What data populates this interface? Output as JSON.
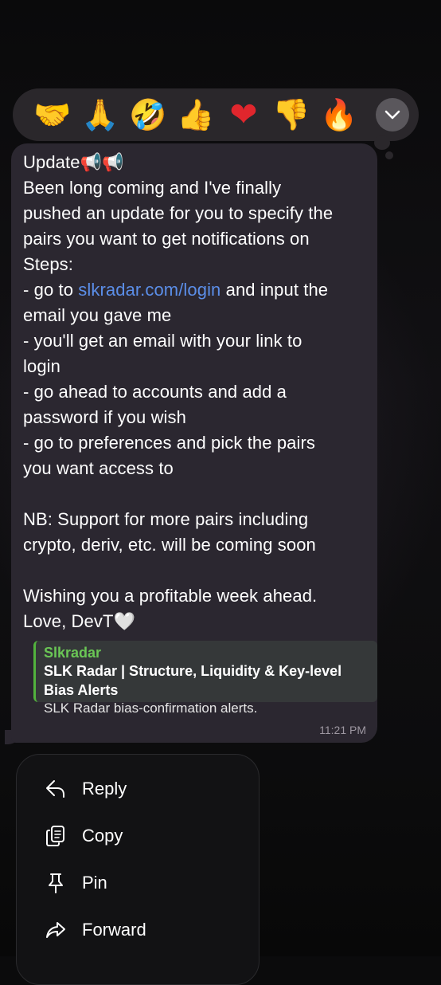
{
  "reactions": [
    {
      "name": "handshake",
      "glyph": "🤝"
    },
    {
      "name": "folded-hands",
      "glyph": "🙏"
    },
    {
      "name": "rofl",
      "glyph": "🤣"
    },
    {
      "name": "thumbs-up",
      "glyph": "👍"
    },
    {
      "name": "heart",
      "glyph": "❤"
    },
    {
      "name": "thumbs-down",
      "glyph": "👍"
    },
    {
      "name": "fire",
      "glyph": "🔥"
    }
  ],
  "message": {
    "line_update": "Update📢📢",
    "body_before_link": "Been long coming and I've finally\npushed an update for you to specify the\npairs you want to get notifications on\nSteps:\n- go to ",
    "link_text": "slkradar.com/login",
    "body_after_link": " and input the\nemail you gave me\n- you'll get an email with your link to\nlogin\n- go ahead to accounts and add a\npassword if you wish\n- go to preferences and pick the pairs\nyou want access to\n\nNB: Support for more pairs including\ncrypto, deriv, etc. will be coming soon\n\nWishing you a profitable week ahead.\nLove, DevT🤍",
    "time": "11:21 PM"
  },
  "link_preview": {
    "site": "Slkradar",
    "title": "SLK Radar | Structure, Liquidity & Key-level Bias Alerts",
    "description": "SLK Radar bias-confirmation alerts."
  },
  "context_menu": {
    "reply": "Reply",
    "copy": "Copy",
    "pin": "Pin",
    "forward": "Forward"
  }
}
